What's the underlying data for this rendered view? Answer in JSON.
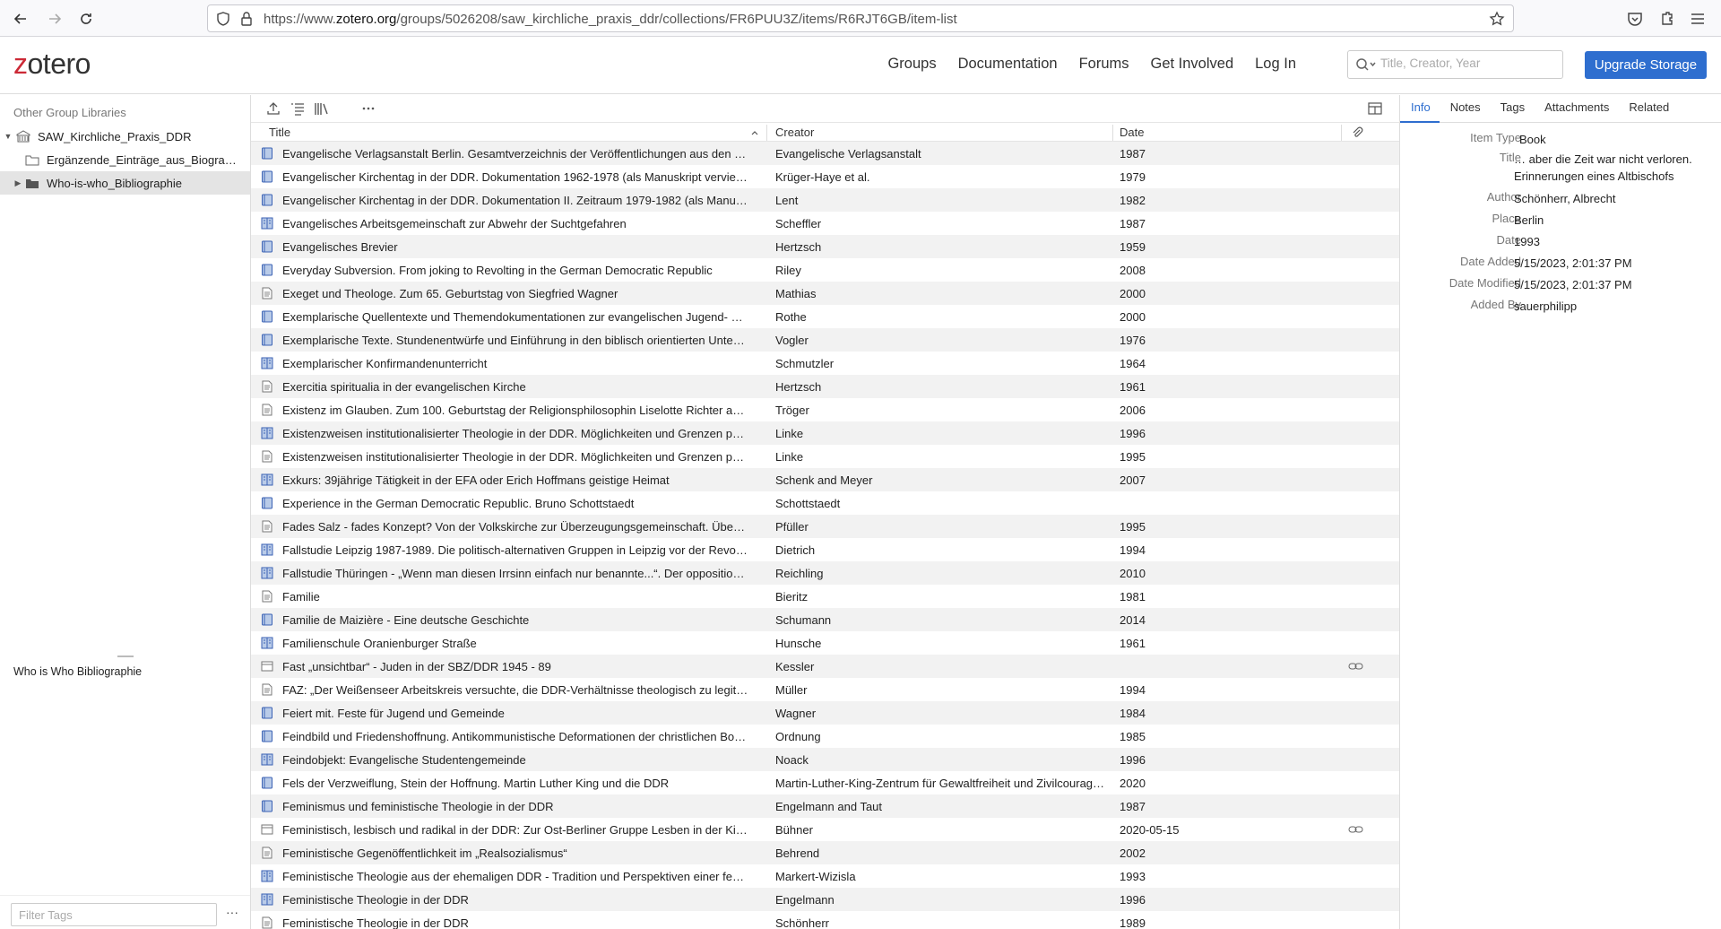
{
  "browser": {
    "url_prefix": "https://www.",
    "url_host": "zotero.org",
    "url_path": "/groups/5026208/saw_kirchliche_praxis_ddr/collections/FR6PUU3Z/items/R6RJT6GB/item-list"
  },
  "header": {
    "logo": "otero",
    "logo_z": "z",
    "nav": [
      "Groups",
      "Documentation",
      "Forums",
      "Get Involved",
      "Log In"
    ],
    "search_placeholder": "Title, Creator, Year",
    "upgrade_label": "Upgrade Storage",
    "accent": "#2e6ecf"
  },
  "left": {
    "heading": "Other Group Libraries",
    "library": "SAW_Kirchliche_Praxis_DDR",
    "collections": [
      "Ergänzende_Einträge_aus_Biogra…",
      "Who-is-who_Bibliographie"
    ],
    "library_note": "Who is Who Bibliographie",
    "tag_filter_placeholder": "Filter Tags",
    "tag_more": "···"
  },
  "items": {
    "columns": {
      "title": "Title",
      "creator": "Creator",
      "date": "Date"
    },
    "sort_indicator": "^",
    "rows": [
      {
        "type": "book",
        "title": "Evangelische Verlagsanstalt Berlin. Gesamtverzeichnis der Veröffentlichungen aus den …",
        "creator": "Evangelische Verlagsanstalt",
        "date": "1987",
        "att": false
      },
      {
        "type": "book",
        "title": "Evangelischer Kirchentag in der DDR. Dokumentation 1962-1978 (als Manuskript vervie…",
        "creator": "Krüger-Haye et al.",
        "date": "1979",
        "att": false
      },
      {
        "type": "book",
        "title": "Evangelischer Kirchentag in der DDR. Dokumentation II. Zeitraum 1979-1982 (als Manu…",
        "creator": "Lent",
        "date": "1982",
        "att": false
      },
      {
        "type": "section",
        "title": "Evangelisches Arbeitsgemeinschaft zur Abwehr der Suchtgefahren",
        "creator": "Scheffler",
        "date": "1987",
        "att": false
      },
      {
        "type": "book",
        "title": "Evangelisches Brevier",
        "creator": "Hertzsch",
        "date": "1959",
        "att": false
      },
      {
        "type": "book",
        "title": "Everyday Subversion. From joking to Revolting in the German Democratic Republic",
        "creator": "Riley",
        "date": "2008",
        "att": false
      },
      {
        "type": "article",
        "title": "Exeget und Theologe. Zum 65. Geburtstag von Siegfried Wagner",
        "creator": "Mathias",
        "date": "2000",
        "att": false
      },
      {
        "type": "book",
        "title": "Exemplarische Quellentexte und Themendokumentationen zur evangelischen Jugend- u…",
        "creator": "Rothe",
        "date": "2000",
        "att": false
      },
      {
        "type": "book",
        "title": "Exemplarische Texte. Stundenentwürfe und Einführung in den biblisch orientierten Unter…",
        "creator": "Vogler",
        "date": "1976",
        "att": false
      },
      {
        "type": "section",
        "title": "Exemplarischer Konfirmandenunterricht",
        "creator": "Schmutzler",
        "date": "1964",
        "att": false
      },
      {
        "type": "article",
        "title": "Exercitia spiritualia in der evangelischen Kirche",
        "creator": "Hertzsch",
        "date": "1961",
        "att": false
      },
      {
        "type": "article",
        "title": "Existenz im Glauben. Zum 100. Geburtstag der Religionsphilosophin Liselotte Richter a…",
        "creator": "Tröger",
        "date": "2006",
        "att": false
      },
      {
        "type": "section",
        "title": "Existenzweisen institutionalisierter Theologie in der DDR. Möglichkeiten und Grenzen p…",
        "creator": "Linke",
        "date": "1996",
        "att": false
      },
      {
        "type": "article",
        "title": "Existenzweisen institutionalisierter Theologie in der DDR. Möglichkeiten und Grenzen p…",
        "creator": "Linke",
        "date": "1995",
        "att": false
      },
      {
        "type": "section",
        "title": "Exkurs: 39jährige Tätigkeit in der EFA oder Erich Hoffmans geistige Heimat",
        "creator": "Schenk and Meyer",
        "date": "2007",
        "att": false
      },
      {
        "type": "book",
        "title": "Experience in the German Democratic Republic. Bruno Schottstaedt",
        "creator": "Schottstaedt",
        "date": "",
        "att": false
      },
      {
        "type": "article",
        "title": "Fades Salz - fades Konzept? Von der Volkskirche zur Überzeugungsgemeinschaft. Über…",
        "creator": "Pfüller",
        "date": "1995",
        "att": false
      },
      {
        "type": "section",
        "title": "Fallstudie Leipzig 1987-1989. Die politisch-alternativen Gruppen in Leipzig vor der Revol…",
        "creator": "Dietrich",
        "date": "1994",
        "att": false
      },
      {
        "type": "section",
        "title": "Fallstudie Thüringen - „Wenn man diesen Irrsinn einfach nur benannte...“. Der oppositio…",
        "creator": "Reichling",
        "date": "2010",
        "att": false
      },
      {
        "type": "article",
        "title": "Familie",
        "creator": "Bieritz",
        "date": "1981",
        "att": false
      },
      {
        "type": "book",
        "title": "Familie de Maizière - Eine deutsche Geschichte",
        "creator": "Schumann",
        "date": "2014",
        "att": false
      },
      {
        "type": "section",
        "title": "Familienschule Oranienburger Straße",
        "creator": "Hunsche",
        "date": "1961",
        "att": false
      },
      {
        "type": "web",
        "title": "Fast „unsichtbar“ - Juden in der SBZ/DDR 1945 - 89",
        "creator": "Kessler",
        "date": "",
        "att": true
      },
      {
        "type": "article",
        "title": "FAZ: „Der Weißenseer Arbeitskreis versuchte, die DDR-Verhältnisse theologisch zu legit…",
        "creator": "Müller",
        "date": "1994",
        "att": false
      },
      {
        "type": "book",
        "title": "Feiert mit. Feste für Jugend und Gemeinde",
        "creator": "Wagner",
        "date": "1984",
        "att": false
      },
      {
        "type": "book",
        "title": "Feindbild und Friedenshoffnung. Antikommunistische Deformationen der christlichen Bot…",
        "creator": "Ordnung",
        "date": "1985",
        "att": false
      },
      {
        "type": "section",
        "title": "Feindobjekt: Evangelische Studentengemeinde",
        "creator": "Noack",
        "date": "1996",
        "att": false
      },
      {
        "type": "book",
        "title": "Fels der Verzweiflung, Stein der Hoffnung. Martin Luther King und die DDR",
        "creator": "Martin-Luther-King-Zentrum für Gewaltfreiheit und Zivilcourag…",
        "date": "2020",
        "att": false
      },
      {
        "type": "book",
        "title": "Feminismus und feministische Theologie in der DDR",
        "creator": "Engelmann and Taut",
        "date": "1987",
        "att": false
      },
      {
        "type": "web",
        "title": "Feministisch, lesbisch und radikal in der DDR: Zur Ost-Berliner Gruppe Lesben in der Ki…",
        "creator": "Bühner",
        "date": "2020-05-15",
        "att": true
      },
      {
        "type": "article",
        "title": "Feministische Gegenöffentlichkeit im „Realsozialismus“",
        "creator": "Behrend",
        "date": "2002",
        "att": false
      },
      {
        "type": "section",
        "title": "Feministische Theologie aus der ehemaligen DDR - Tradition und Perspektiven einer fe…",
        "creator": "Markert-Wizisla",
        "date": "1993",
        "att": false
      },
      {
        "type": "section",
        "title": "Feministische Theologie in der DDR",
        "creator": "Engelmann",
        "date": "1996",
        "att": false
      },
      {
        "type": "article",
        "title": "Feministische Theologie in der DDR",
        "creator": "Schönherr",
        "date": "1989",
        "att": false
      }
    ]
  },
  "details": {
    "tabs": [
      "Info",
      "Notes",
      "Tags",
      "Attachments",
      "Related"
    ],
    "fields": [
      {
        "label": "Item Type",
        "value": "Book"
      },
      {
        "label": "Title",
        "value": "… aber die Zeit war nicht verloren. Erinnerungen eines Altbischofs"
      },
      {
        "label": "Author",
        "value": "Schönherr, Albrecht"
      },
      {
        "label": "Place",
        "value": "Berlin"
      },
      {
        "label": "Date",
        "value": "1993"
      },
      {
        "label": "Date Added",
        "value": "5/15/2023, 2:01:37 PM"
      },
      {
        "label": "Date Modified",
        "value": "5/15/2023, 2:01:37 PM"
      },
      {
        "label": "Added By",
        "value": "sauerphilipp"
      }
    ]
  }
}
